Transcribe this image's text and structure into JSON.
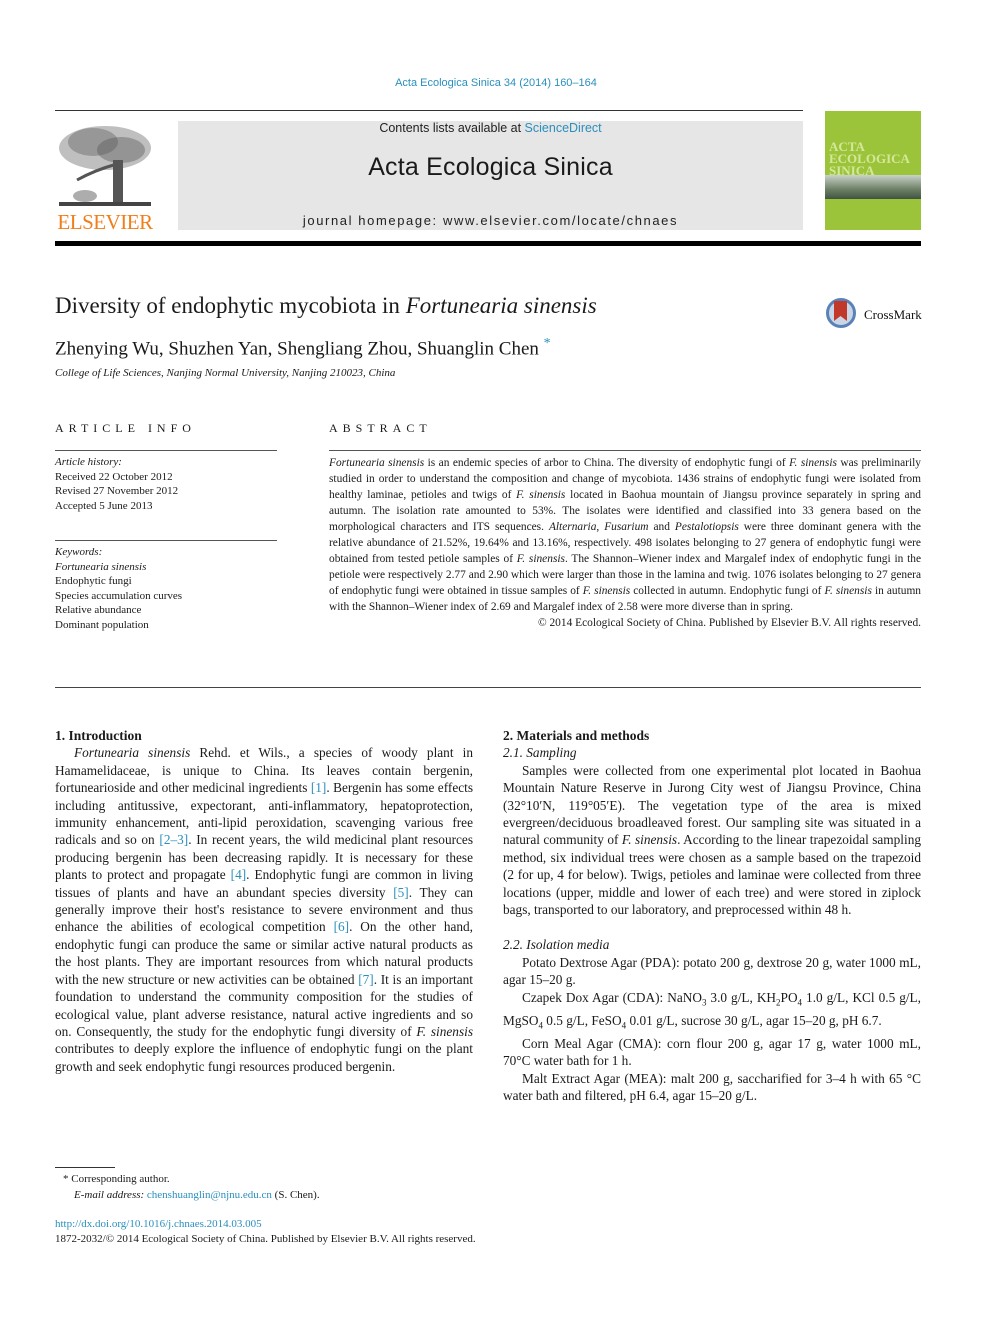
{
  "header": {
    "citation": "Acta Ecologica Sinica 34 (2014) 160–164",
    "contents_prefix": "Contents lists available at ",
    "contents_link": "ScienceDirect",
    "journal_title": "Acta Ecologica Sinica",
    "homepage": "journal homepage: www.elsevier.com/locate/chnaes",
    "publisher_logo_text": "ELSEVIER",
    "cover_title_lines": [
      "ACTA",
      "ECOLOGICA",
      "SINICA"
    ],
    "crossmark_label": "CrossMark"
  },
  "article": {
    "title_plain": "Diversity of endophytic mycobiota in ",
    "title_italic": "Fortunearia sinensis",
    "authors": "Zhenying Wu, Shuzhen Yan, Shengliang Zhou, Shuanglin Chen",
    "author_mark": "*",
    "affiliation": "College of Life Sciences, Nanjing Normal University, Nanjing 210023, China"
  },
  "article_info": {
    "label": "ARTICLE INFO",
    "history_heading": "Article history:",
    "history": [
      "Received 22 October 2012",
      "Revised 27 November 2012",
      "Accepted 5 June 2013"
    ],
    "keywords_heading": "Keywords:",
    "keywords": [
      "Fortunearia sinensis",
      "Endophytic fungi",
      "Species accumulation curves",
      "Relative abundance",
      "Dominant population"
    ]
  },
  "abstract": {
    "label": "ABSTRACT",
    "s1_italic": "Fortunearia sinensis",
    "s1": " is an endemic species of arbor to China. The diversity of endophytic fungi of ",
    "s1b_italic": "F. sinensis",
    "s2": " was preliminarily studied in order to understand the composition and change of mycobiota. 1436 strains of endophytic fungi were isolated from healthy laminae, petioles and twigs of ",
    "s2_italic": "F. sinensis",
    "s3": " located in Baohua mountain of Jiangsu province separately in spring and autumn. The isolation rate amounted to 53%. The isolates were identified and classified into 33 genera based on the morphological characters and ITS sequences. ",
    "g1": "Alternaria",
    "g_sep1": ", ",
    "g2": "Fusarium",
    "g_sep2": " and ",
    "g3": "Pestalotiopsis",
    "s4": " were three dominant genera with the relative abundance of 21.52%, 19.64% and 13.16%, respectively. 498 isolates belonging to 27 genera of endophytic fungi were obtained from tested petiole samples of ",
    "s4_italic": "F. sinensis",
    "s5": ". The Shannon–Wiener index and Margalef index of endophytic fungi in the petiole were respectively 2.77 and 2.90 which were larger than those in the lamina and twig. 1076 isolates belonging to 27 genera of endophytic fungi were obtained in tissue samples of ",
    "s5_italic": "F. sinensis",
    "s6": " collected in autumn. Endophytic fungi of ",
    "s6_italic": "F. sinensis",
    "s7": " in autumn with the Shannon–Wiener index of 2.69 and Margalef index of 2.58 were more diverse than in spring.",
    "copyright": "© 2014 Ecological Society of China. Published by Elsevier B.V. All rights reserved."
  },
  "intro": {
    "heading": "1. Introduction",
    "p_italic": "Fortunearia sinensis",
    "p1": " Rehd. et Wils., a species of woody plant in Hamamelidaceae, is unique to China. Its leaves contain bergenin, fortunearioside and other medicinal ingredients ",
    "r1": "[1]",
    "p2": ". Bergenin has some effects including antitussive, expectorant, anti-inflammatory, hepatoprotection, immunity enhancement, anti-lipid peroxidation, scavenging various free radicals and so on ",
    "r2": "[2–3]",
    "p3": ". In recent years, the wild medicinal plant resources producing bergenin has been decreasing rapidly. It is necessary for these plants to protect and propagate ",
    "r3": "[4]",
    "p4": ". Endophytic fungi are common in living tissues of plants and have an abundant species diversity ",
    "r4": "[5]",
    "p5": ". They can generally improve their host's resistance to severe environment and thus enhance the abilities of ecological competition ",
    "r5": "[6]",
    "p6": ". On the other hand, endophytic fungi can produce the same or similar active natural products as the host plants. They are important resources from which natural products with the new structure or new activities can be obtained ",
    "r6": "[7]",
    "p7": ". It is an important foundation to understand the community composition for the studies of ecological value, plant adverse resistance, natural active ingredients and so on. Consequently, the study for the endophytic fungi diversity of ",
    "p7_italic": "F. sinensis",
    "p8": " contributes to deeply explore the influence of endophytic fungi on the plant growth and seek endophytic fungi resources produced bergenin."
  },
  "methods": {
    "heading": "2. Materials and methods",
    "sampling_heading": "2.1. Sampling",
    "sampling_a": "Samples were collected from one experimental plot located in Baohua Mountain Nature Reserve in Jurong City west of Jiangsu Province, China (32°10′N, 119°05′E). The vegetation type of the area is mixed evergreen/deciduous broadleaved forest. Our sampling site was situated in a natural community of ",
    "sampling_italic": "F. sinensis",
    "sampling_b": ". According to the linear trapezoidal sampling method, six individual trees were chosen as a sample based on the trapezoid (2 for up, 4 for below). Twigs, petioles and laminae were collected from three locations (upper, middle and lower of each tree) and were stored in ziplock bags, transported to our laboratory, and preprocessed within 48 h.",
    "media_heading": "2.2. Isolation media",
    "pda": "Potato Dextrose Agar (PDA): potato 200 g, dextrose 20 g, water 1000 mL, agar 15–20 g.",
    "cda_a": "Czapek Dox Agar (CDA): NaNO",
    "cda_s1": "3",
    "cda_b": " 3.0 g/L, KH",
    "cda_s2": "2",
    "cda_c": "PO",
    "cda_s3": "4",
    "cda_d": " 1.0 g/L, KCl 0.5 g/L, MgSO",
    "cda_s4": "4",
    "cda_e": " 0.5 g/L, FeSO",
    "cda_s5": "4",
    "cda_f": " 0.01 g/L, sucrose 30 g/L, agar 15–20 g, pH 6.7.",
    "cma": "Corn Meal Agar (CMA): corn flour 200 g, agar 17 g, water 1000 mL, 70°C water bath for 1 h.",
    "mea": "Malt Extract Agar (MEA): malt 200 g, saccharified for 3–4 h with 65 °C water bath and filtered, pH 6.4, agar 15–20 g/L."
  },
  "footnote": {
    "corresponding": "* Corresponding author.",
    "email_label": "E-mail address: ",
    "email": "chenshuanglin@njnu.edu.cn",
    "email_suffix": " (S. Chen)."
  },
  "footer": {
    "doi": "http://dx.doi.org/10.1016/j.chnaes.2014.03.005",
    "issn": "1872-2032/© 2014 Ecological Society of China. Published by Elsevier B.V. All rights reserved."
  }
}
